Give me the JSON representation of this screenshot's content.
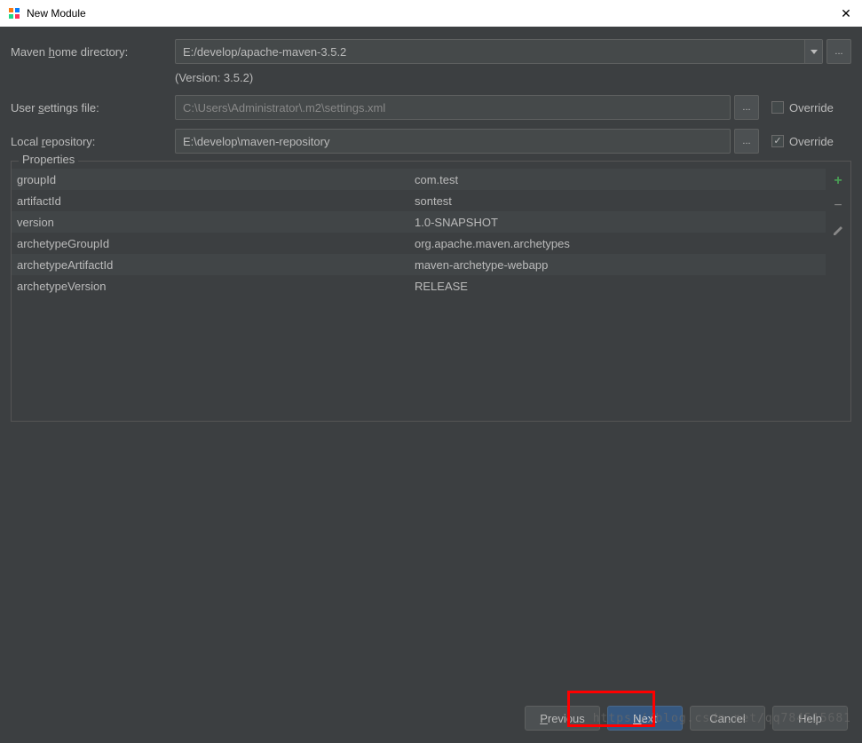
{
  "window": {
    "title": "New Module"
  },
  "form": {
    "mavenHome": {
      "label_pre": "Maven ",
      "label_u": "h",
      "label_post": "ome directory:",
      "value": "E:/develop/apache-maven-3.5.2"
    },
    "version": "(Version: 3.5.2)",
    "userSettings": {
      "label_pre": "User ",
      "label_u": "s",
      "label_post": "ettings file:",
      "value": "C:\\Users\\Administrator\\.m2\\settings.xml",
      "override": "Override",
      "overrideChecked": false
    },
    "localRepo": {
      "label_pre": "Local ",
      "label_u": "r",
      "label_post": "epository:",
      "value": "E:\\develop\\maven-repository",
      "override": "Override",
      "overrideChecked": true
    }
  },
  "properties": {
    "title": "Properties",
    "rows": [
      {
        "key": "groupId",
        "value": "com.test"
      },
      {
        "key": "artifactId",
        "value": "sontest"
      },
      {
        "key": "version",
        "value": "1.0-SNAPSHOT"
      },
      {
        "key": "archetypeGroupId",
        "value": "org.apache.maven.archetypes"
      },
      {
        "key": "archetypeArtifactId",
        "value": "maven-archetype-webapp"
      },
      {
        "key": "archetypeVersion",
        "value": "RELEASE"
      }
    ]
  },
  "buttons": {
    "previous_u": "P",
    "previous": "revious",
    "next_u": "N",
    "next": "ext",
    "cancel": "Cancel",
    "help": "Help"
  },
  "watermark": "https://blog.csdn.net/qq784515681"
}
